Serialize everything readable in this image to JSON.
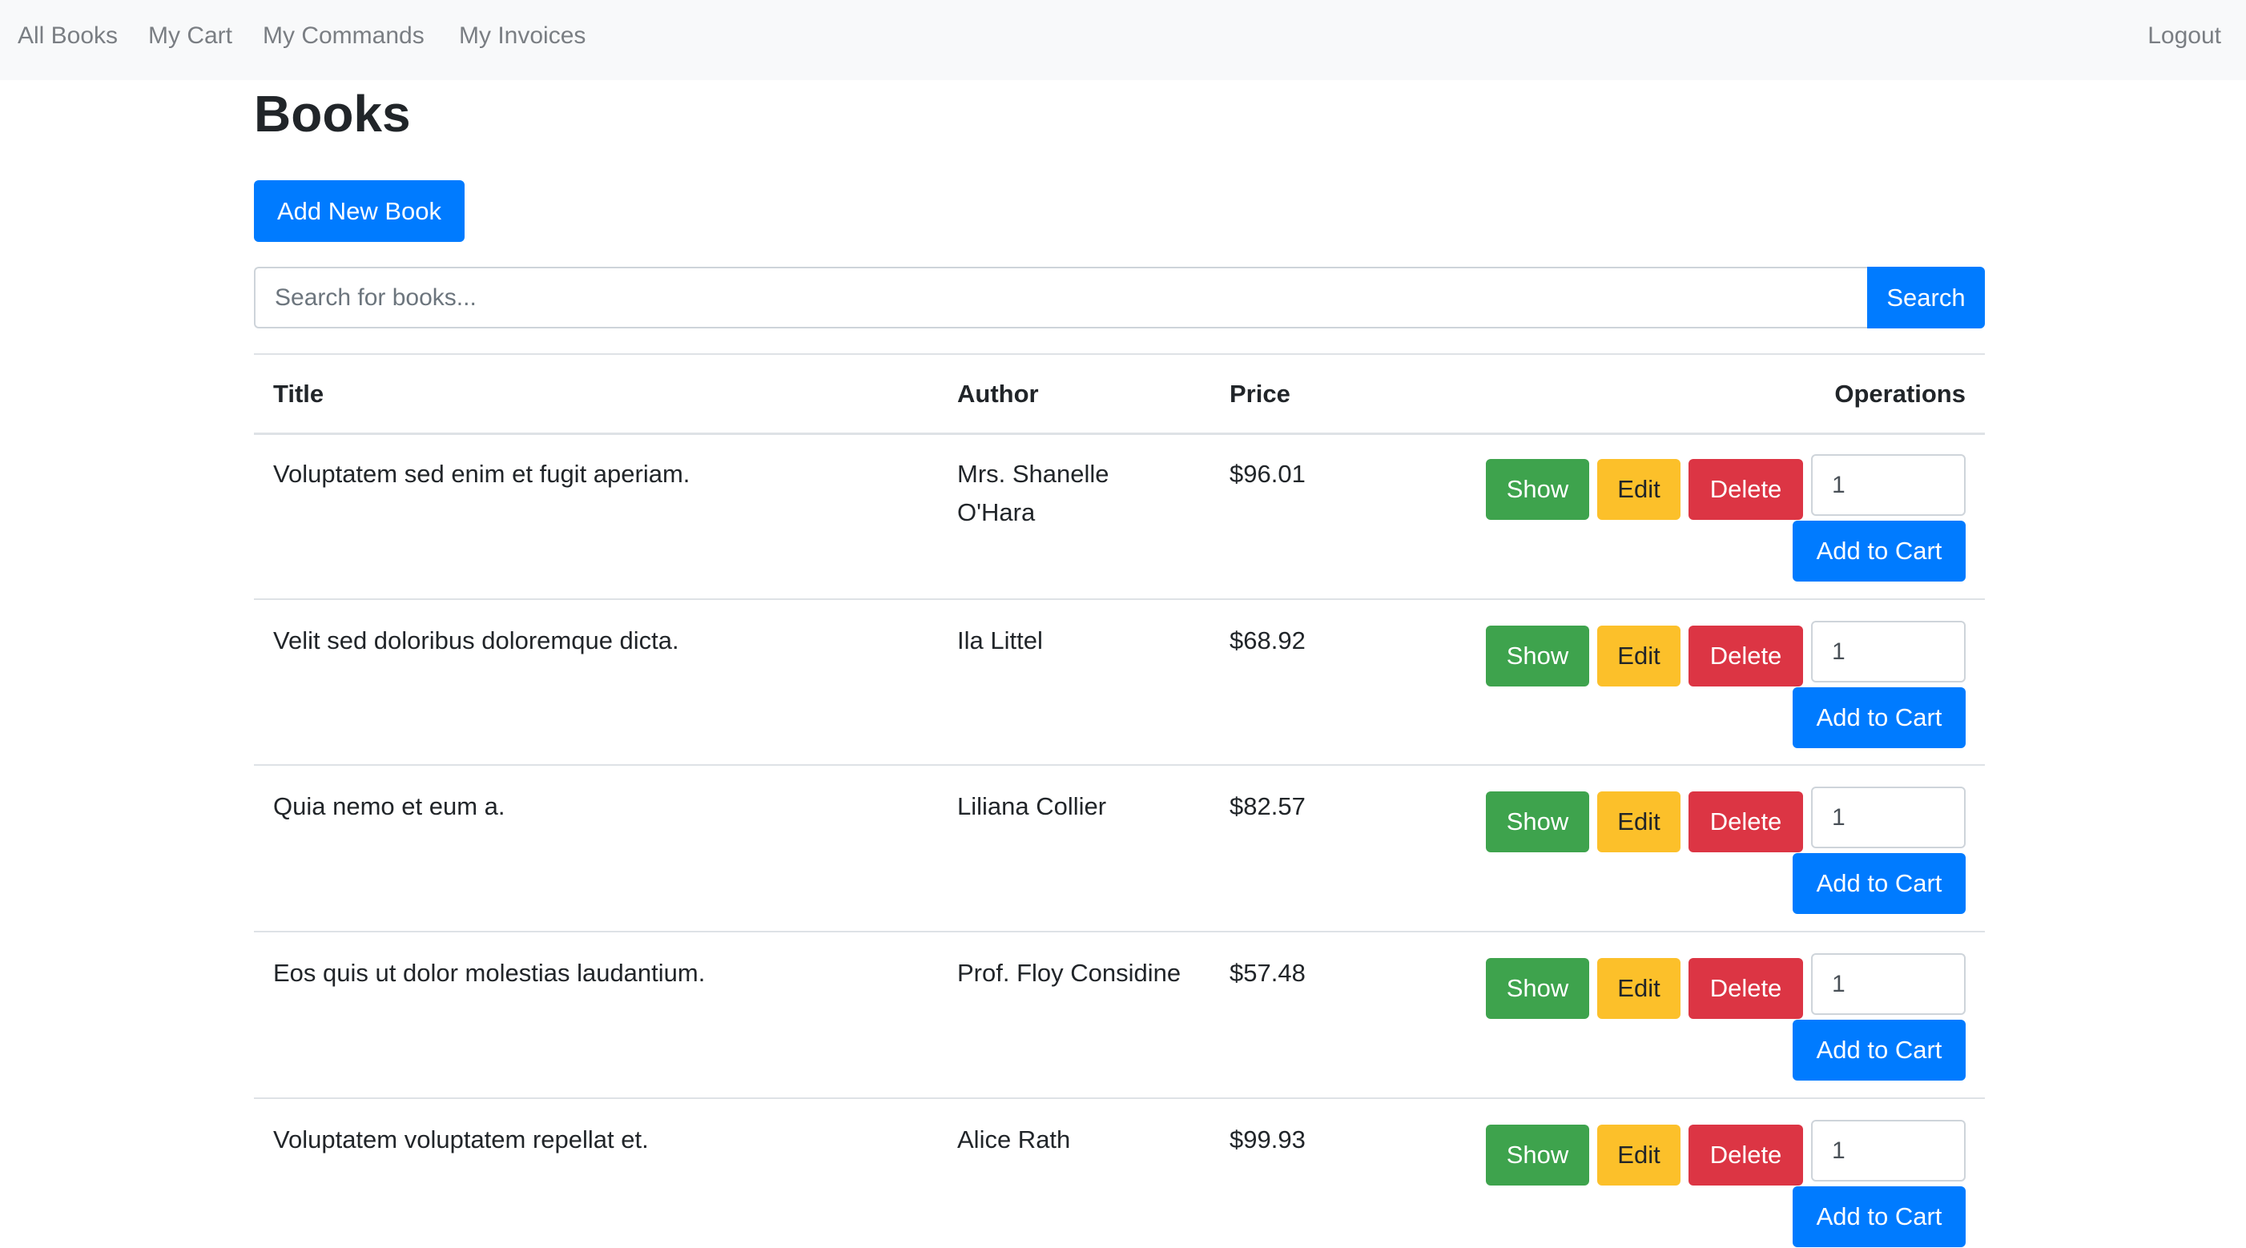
{
  "nav": {
    "items": [
      "All Books",
      "My Cart",
      "My Commands",
      "My Invoices"
    ],
    "logout": "Logout"
  },
  "page": {
    "title": "Books",
    "add_button": "Add New Book"
  },
  "search": {
    "placeholder": "Search for books...",
    "button": "Search"
  },
  "table": {
    "headers": {
      "title": "Title",
      "author": "Author",
      "price": "Price",
      "operations": "Operations"
    },
    "rows": [
      {
        "title": "Voluptatem sed enim et fugit aperiam.",
        "author_lines": [
          "Mrs. Shanelle",
          "O'Hara"
        ],
        "price": "$96.01",
        "qty": "1"
      },
      {
        "title": "Velit sed doloribus doloremque dicta.",
        "author_lines": [
          "Ila Littel",
          ""
        ],
        "price": "$68.92",
        "qty": "1"
      },
      {
        "title": "Quia nemo et eum a.",
        "author_lines": [
          "Liliana Collier",
          ""
        ],
        "price": "$82.57",
        "qty": "1"
      },
      {
        "title": "Eos quis ut dolor molestias laudantium.",
        "author_lines": [
          "Prof. Floy Considine",
          ""
        ],
        "price": "$57.48",
        "qty": "1"
      },
      {
        "title": "Voluptatem voluptatem repellat et.",
        "author_lines": [
          "Alice Rath",
          ""
        ],
        "price": "$99.93",
        "qty": "1"
      }
    ],
    "actions": {
      "show": "Show",
      "edit": "Edit",
      "delete": "Delete",
      "add_to_cart": "Add to Cart"
    }
  },
  "colors": {
    "primary": "#007bff",
    "success": "#3ea34d",
    "warning": "#fcc02a",
    "danger": "#dc3544",
    "navbar_bg": "#f8f9fa"
  }
}
